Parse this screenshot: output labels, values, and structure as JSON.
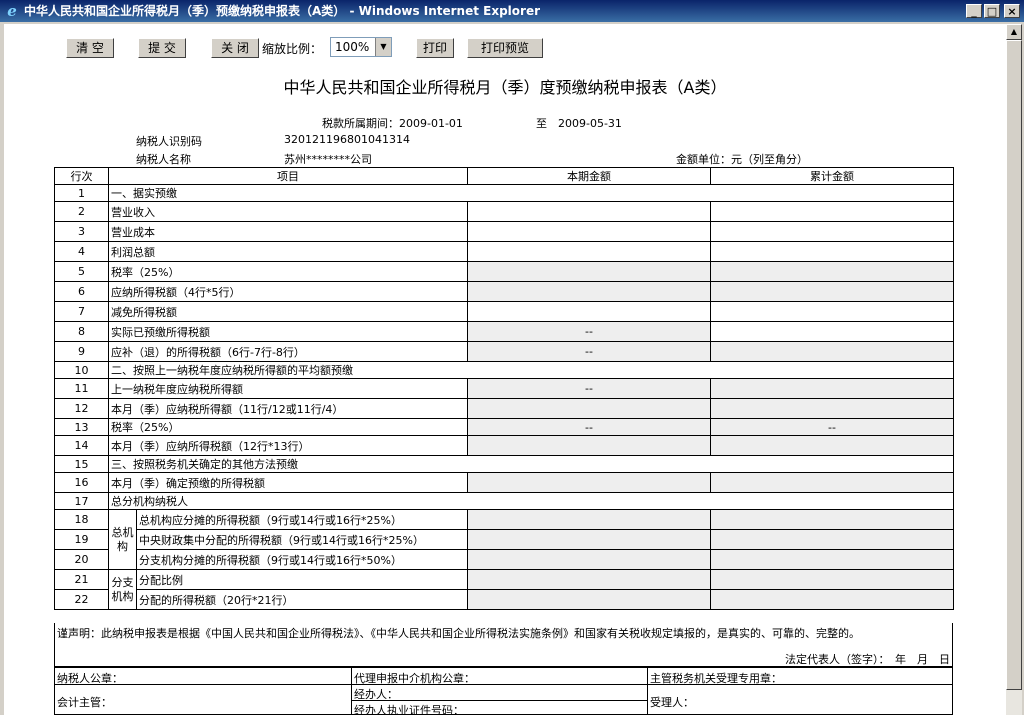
{
  "window": {
    "title": "中华人民共和国企业所得税月（季）预缴纳税申报表（A类） - Windows Internet Explorer",
    "min": "_",
    "max": "□",
    "close": "×"
  },
  "toolbar": {
    "clear": "清 空",
    "submit": "提 交",
    "close": "关 闭",
    "zoom_label": "缩放比例：",
    "zoom_value": "100%",
    "print": "打印",
    "preview": "打印预览"
  },
  "form": {
    "title": "中华人民共和国企业所得税月（季）度预缴纳税申报表（A类）",
    "period_label": "税款所属期间：2009-01-01",
    "period_to": "至　2009-05-31",
    "taxpayer_id_label": "纳税人识别码",
    "taxpayer_id": "320121196801041314",
    "taxpayer_name_label": "纳税人名称",
    "taxpayer_name": "苏州********公司",
    "unit": "金额单位：元（列至角分）",
    "col_no": "行次",
    "col_item": "项目",
    "col_current": "本期金额",
    "col_cumulative": "累计金额",
    "rows": {
      "r1": "一、据实预缴",
      "r2": "营业收入",
      "r3": "营业成本",
      "r4": "利润总额",
      "r5": "税率（25%）",
      "r6": "应纳所得税额（4行*5行）",
      "r7": "减免所得税额",
      "r8": "实际已预缴所得税额",
      "r9": "应补（退）的所得税额（6行-7行-8行）",
      "r10": "二、按照上一纳税年度应纳税所得额的平均额预缴",
      "r11": "上一纳税年度应纳税所得额",
      "r12": "本月（季）应纳税所得额（11行/12或11行/4）",
      "r13": "税率（25%）",
      "r14": "本月（季）应纳所得税额（12行*13行）",
      "r15": "三、按照税务机关确定的其他方法预缴",
      "r16": "本月（季）确定预缴的所得税额",
      "r17": "总分机构纳税人",
      "g1": "总机构",
      "r18": "总机构应分摊的所得税额（9行或14行或16行*25%）",
      "r19": "中央财政集中分配的所得税额（9行或14行或16行*25%）",
      "r20": "分支机构分摊的所得税额（9行或14行或16行*50%）",
      "g2": "分支机构",
      "r21": "分配比例",
      "r22": "分配的所得税额（20行*21行）"
    },
    "dash": "--",
    "declaration": "谨声明：此纳税申报表是根据《中国人民共和国企业所得税法》、《中华人民共和国企业所得税法实施条例》和国家有关税收规定填报的，是真实的、可靠的、完整的。",
    "legal_rep": "法定代表人（签字）：　年　月　日",
    "seal_taxpayer": "纳税人公章：",
    "accountant": "会计主管：",
    "agent_seal": "代理申报中介机构公章：",
    "handler": "经办人：",
    "handler_cert": "经办人执业证件号码：",
    "tax_office": "主管税务机关受理专用章：",
    "receiver": "受理人："
  }
}
